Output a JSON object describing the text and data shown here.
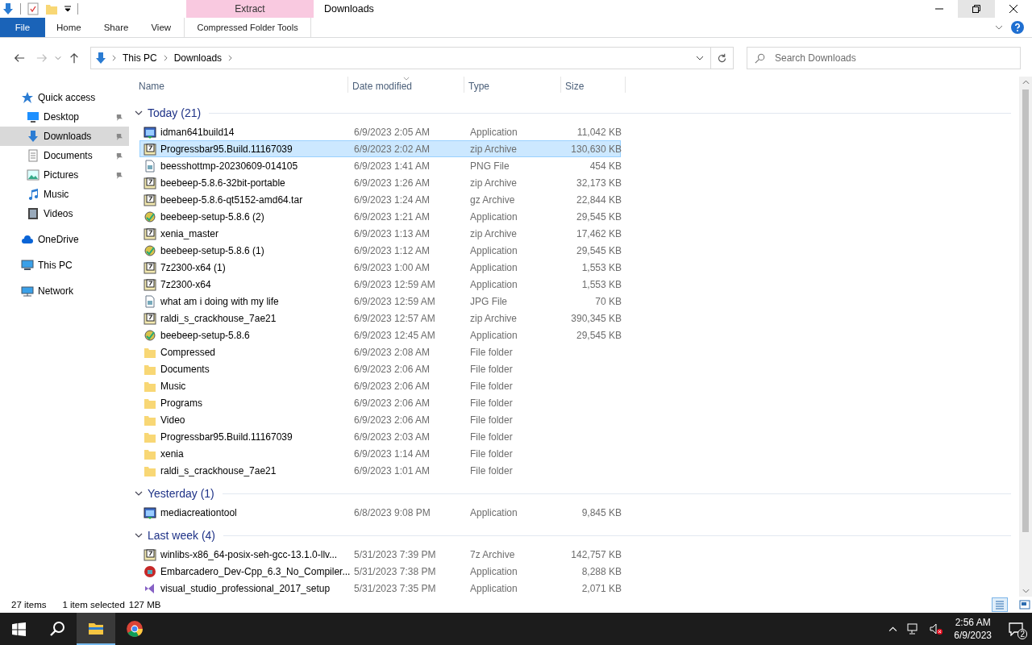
{
  "window": {
    "title": "Downloads"
  },
  "ribbon": {
    "context_label": "Extract",
    "tabs": [
      {
        "label": "File",
        "selected": true,
        "kind": "file"
      },
      {
        "label": "Home",
        "selected": false,
        "kind": "tab"
      },
      {
        "label": "Share",
        "selected": false,
        "kind": "tab"
      },
      {
        "label": "View",
        "selected": false,
        "kind": "tab"
      },
      {
        "label": "Compressed Folder Tools",
        "selected": false,
        "kind": "context"
      }
    ]
  },
  "address": {
    "crumbs": [
      "This PC",
      "Downloads"
    ]
  },
  "search": {
    "placeholder": "Search Downloads"
  },
  "sidebar": {
    "items": [
      {
        "label": "Quick access",
        "kind": "star",
        "selected": false,
        "pinned": false,
        "indent": false
      },
      {
        "label": "Desktop",
        "kind": "desktop",
        "selected": false,
        "pinned": true,
        "indent": true
      },
      {
        "label": "Downloads",
        "kind": "download",
        "selected": true,
        "pinned": true,
        "indent": true
      },
      {
        "label": "Documents",
        "kind": "document",
        "selected": false,
        "pinned": true,
        "indent": true
      },
      {
        "label": "Pictures",
        "kind": "picture",
        "selected": false,
        "pinned": true,
        "indent": true
      },
      {
        "label": "Music",
        "kind": "music",
        "selected": false,
        "pinned": false,
        "indent": true
      },
      {
        "label": "Videos",
        "kind": "video",
        "selected": false,
        "pinned": false,
        "indent": true
      },
      {
        "label": "OneDrive",
        "kind": "cloud",
        "selected": false,
        "pinned": false,
        "indent": false
      },
      {
        "label": "This PC",
        "kind": "pc",
        "selected": false,
        "pinned": false,
        "indent": false
      },
      {
        "label": "Network",
        "kind": "network",
        "selected": false,
        "pinned": false,
        "indent": false
      }
    ]
  },
  "table": {
    "columns": [
      "Name",
      "Date modified",
      "Type",
      "Size"
    ],
    "groups": [
      {
        "title": "Today (21)",
        "expanded": true,
        "rows": [
          {
            "name": "idman641build14",
            "date": "6/9/2023 2:05 AM",
            "type": "Application",
            "size": "11,042 KB",
            "kind": "app",
            "selected": false
          },
          {
            "name": "Progressbar95.Build.11167039",
            "date": "6/9/2023 2:02 AM",
            "type": "zip Archive",
            "size": "130,630 KB",
            "kind": "zip",
            "selected": true
          },
          {
            "name": "beesshottmp-20230609-014105",
            "date": "6/9/2023 1:41 AM",
            "type": "PNG File",
            "size": "454 KB",
            "kind": "image",
            "selected": false
          },
          {
            "name": "beebeep-5.8.6-32bit-portable",
            "date": "6/9/2023 1:26 AM",
            "type": "zip Archive",
            "size": "32,173 KB",
            "kind": "zip",
            "selected": false
          },
          {
            "name": "beebeep-5.8.6-qt5152-amd64.tar",
            "date": "6/9/2023 1:24 AM",
            "type": "gz Archive",
            "size": "22,844 KB",
            "kind": "zip",
            "selected": false
          },
          {
            "name": "beebeep-setup-5.8.6 (2)",
            "date": "6/9/2023 1:21 AM",
            "type": "Application",
            "size": "29,545 KB",
            "kind": "setup",
            "selected": false
          },
          {
            "name": "xenia_master",
            "date": "6/9/2023 1:13 AM",
            "type": "zip Archive",
            "size": "17,462 KB",
            "kind": "zip",
            "selected": false
          },
          {
            "name": "beebeep-setup-5.8.6 (1)",
            "date": "6/9/2023 1:12 AM",
            "type": "Application",
            "size": "29,545 KB",
            "kind": "setup",
            "selected": false
          },
          {
            "name": "7z2300-x64 (1)",
            "date": "6/9/2023 1:00 AM",
            "type": "Application",
            "size": "1,553 KB",
            "kind": "sevenzip",
            "selected": false
          },
          {
            "name": "7z2300-x64",
            "date": "6/9/2023 12:59 AM",
            "type": "Application",
            "size": "1,553 KB",
            "kind": "sevenzip",
            "selected": false
          },
          {
            "name": "what am i doing with my life",
            "date": "6/9/2023 12:59 AM",
            "type": "JPG File",
            "size": "70 KB",
            "kind": "image",
            "selected": false
          },
          {
            "name": "raldi_s_crackhouse_7ae21",
            "date": "6/9/2023 12:57 AM",
            "type": "zip Archive",
            "size": "390,345 KB",
            "kind": "zip",
            "selected": false
          },
          {
            "name": "beebeep-setup-5.8.6",
            "date": "6/9/2023 12:45 AM",
            "type": "Application",
            "size": "29,545 KB",
            "kind": "setup",
            "selected": false
          },
          {
            "name": "Compressed",
            "date": "6/9/2023 2:08 AM",
            "type": "File folder",
            "kind": "folder",
            "selected": false
          },
          {
            "name": "Documents",
            "date": "6/9/2023 2:06 AM",
            "type": "File folder",
            "kind": "folder",
            "selected": false
          },
          {
            "name": "Music",
            "date": "6/9/2023 2:06 AM",
            "type": "File folder",
            "kind": "folder",
            "selected": false
          },
          {
            "name": "Programs",
            "date": "6/9/2023 2:06 AM",
            "type": "File folder",
            "kind": "folder",
            "selected": false
          },
          {
            "name": "Video",
            "date": "6/9/2023 2:06 AM",
            "type": "File folder",
            "kind": "folder",
            "selected": false
          },
          {
            "name": "Progressbar95.Build.11167039",
            "date": "6/9/2023 2:03 AM",
            "type": "File folder",
            "kind": "folder",
            "selected": false
          },
          {
            "name": "xenia",
            "date": "6/9/2023 1:14 AM",
            "type": "File folder",
            "kind": "folder",
            "selected": false
          },
          {
            "name": "raldi_s_crackhouse_7ae21",
            "date": "6/9/2023 1:01 AM",
            "type": "File folder",
            "kind": "folder",
            "selected": false
          }
        ]
      },
      {
        "title": "Yesterday (1)",
        "expanded": true,
        "rows": [
          {
            "name": "mediacreationtool",
            "date": "6/8/2023 9:08 PM",
            "type": "Application",
            "size": "9,845 KB",
            "kind": "app",
            "selected": false
          }
        ]
      },
      {
        "title": "Last week (4)",
        "expanded": true,
        "rows": [
          {
            "name": "winlibs-x86_64-posix-seh-gcc-13.1.0-llv...",
            "date": "5/31/2023 7:39 PM",
            "type": "7z Archive",
            "size": "142,757 KB",
            "kind": "sevenzip",
            "selected": false
          },
          {
            "name": "Embarcadero_Dev-Cpp_6.3_No_Compiler...",
            "date": "5/31/2023 7:38 PM",
            "type": "Application",
            "size": "8,288 KB",
            "kind": "devcpp",
            "selected": false
          },
          {
            "name": "visual_studio_professional_2017_setup",
            "date": "5/31/2023 7:35 PM",
            "type": "Application",
            "size": "2,071 KB",
            "kind": "vs",
            "selected": false
          }
        ]
      }
    ]
  },
  "status_bar": {
    "items": "27 items",
    "selection": "1 item selected",
    "size": "127 MB"
  },
  "taskbar": {
    "apps": [
      {
        "kind": "explorer",
        "selected": true
      },
      {
        "kind": "chrome",
        "selected": false
      }
    ],
    "time": "2:56 AM",
    "date": "6/9/2023",
    "notifications": "2"
  }
}
